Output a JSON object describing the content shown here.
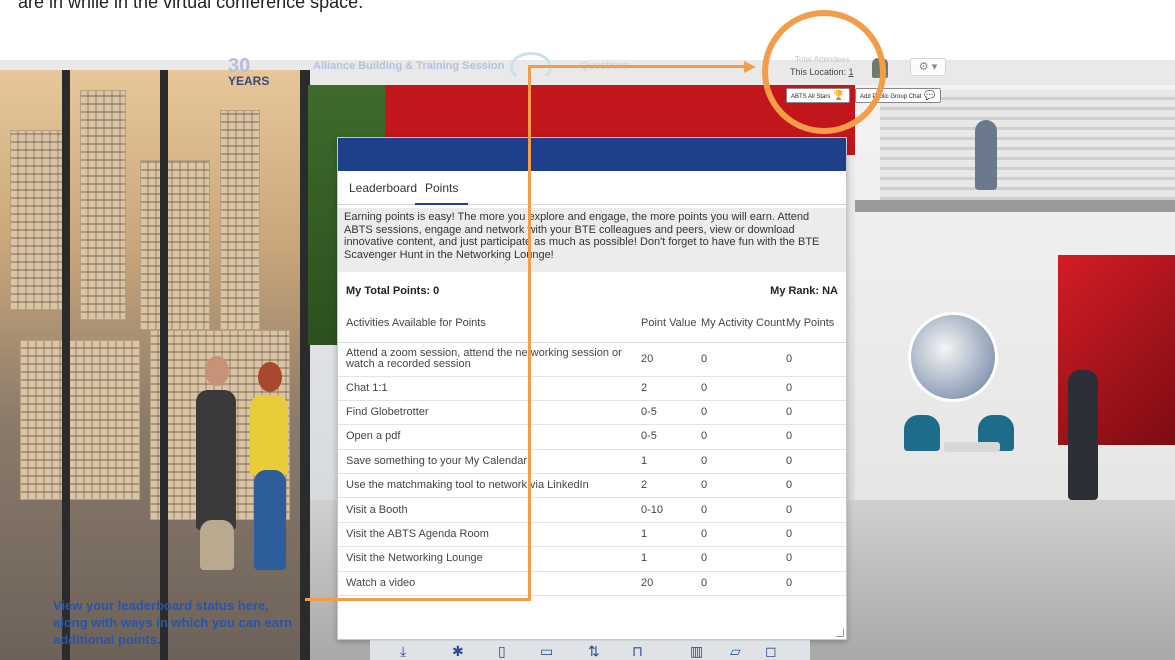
{
  "page": {
    "caption_top": "are in while in the virtual conference space."
  },
  "header": {
    "logo_text": "YEARS",
    "logo_number": "30",
    "event_title": "Alliance Building & Training Session",
    "blurred_text": "Questions",
    "location_top": "Total Attendees",
    "location_label": "This Location:",
    "location_count": "1",
    "settings_icon": "gear-icon",
    "abts_all_stars_label": "ABTS All Stars",
    "abts_all_stars_icon": "trophy-icon",
    "public_chat_label": "Add Public Group Chat",
    "public_chat_icon": "chat-bubbles-icon"
  },
  "modal": {
    "tabs": [
      "Leaderboard",
      "Points"
    ],
    "active_tab": "Points",
    "intro": "Earning points is easy! The more you explore and engage, the more points you will earn. Attend ABTS sessions, engage and network with your BTE colleagues and peers, view or download innovative content, and just participate as much as possible! Don't forget to have fun with the BTE Scavenger Hunt in the Networking Lounge!",
    "total_points_label": "My Total Points: 0",
    "rank_label": "My Rank: NA",
    "columns": [
      "Activities Available for Points",
      "Point Value",
      "My Activity Count",
      "My Points"
    ],
    "rows": [
      {
        "activity": "Attend a zoom session, attend the networking session or watch a recorded session",
        "value": "20",
        "count": "0",
        "points": "0"
      },
      {
        "activity": "Chat 1:1",
        "value": "2",
        "count": "0",
        "points": "0"
      },
      {
        "activity": "Find Globetrotter",
        "value": "0-5",
        "count": "0",
        "points": "0"
      },
      {
        "activity": "Open a pdf",
        "value": "0-5",
        "count": "0",
        "points": "0"
      },
      {
        "activity": "Save something to your My Calendar",
        "value": "1",
        "count": "0",
        "points": "0"
      },
      {
        "activity": "Use the matchmaking tool to network via LinkedIn",
        "value": "2",
        "count": "0",
        "points": "0"
      },
      {
        "activity": "Visit a Booth",
        "value": "0-10",
        "count": "0",
        "points": "0"
      },
      {
        "activity": "Visit the ABTS Agenda Room",
        "value": "1",
        "count": "0",
        "points": "0"
      },
      {
        "activity": "Visit the Networking Lounge",
        "value": "1",
        "count": "0",
        "points": "0"
      },
      {
        "activity": "Watch a video",
        "value": "20",
        "count": "0",
        "points": "0"
      }
    ]
  },
  "toolbar": {
    "icons": [
      "download-icon",
      "asterisk-icon",
      "bookmark-icon",
      "briefcase-icon",
      "signpost-icon",
      "hierarchy-icon",
      "trash-icon",
      "chat-icon",
      "help-icon"
    ]
  },
  "annotation": {
    "callout": "View your leaderboard status here, along with ways in which you can earn additional points.",
    "accent_color": "#f39c4a",
    "callout_color": "#2955a8"
  },
  "colors": {
    "modal_header": "#1e3f8a",
    "brand_red": "#c2161d"
  }
}
